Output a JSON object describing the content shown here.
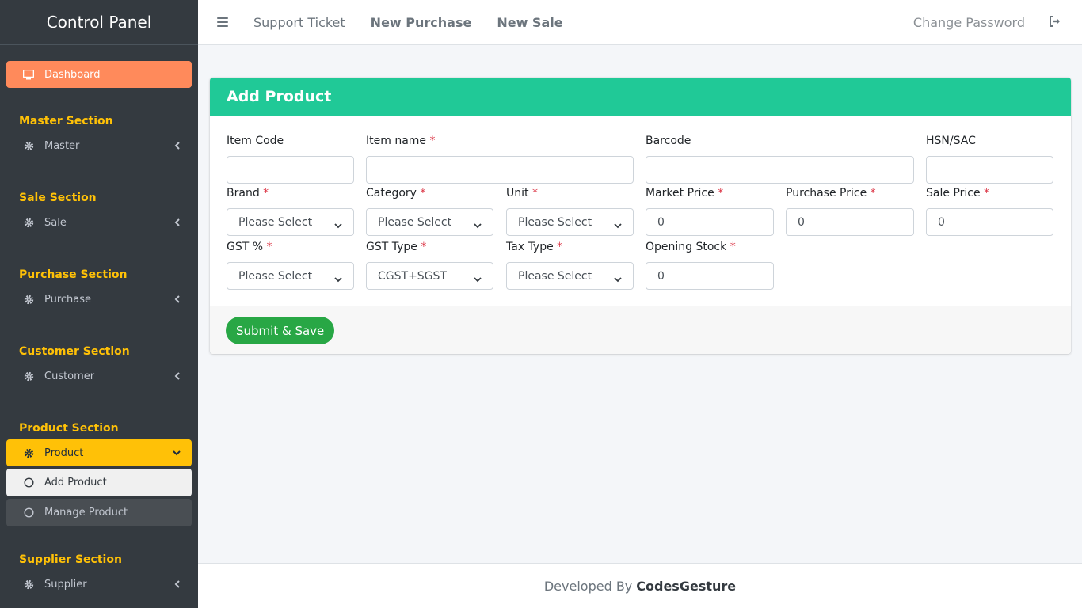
{
  "brand": "Control Panel",
  "sidebar": {
    "dashboard": "Dashboard",
    "sections": [
      {
        "title": "Master Section",
        "item": "Master"
      },
      {
        "title": "Sale Section",
        "item": "Sale"
      },
      {
        "title": "Purchase Section",
        "item": "Purchase"
      },
      {
        "title": "Customer Section",
        "item": "Customer"
      },
      {
        "title": "Product Section",
        "item": "Product"
      },
      {
        "title": "Supplier Section",
        "item": "Supplier"
      }
    ],
    "subitems": [
      "Add Product",
      "Manage Product"
    ]
  },
  "topbar": {
    "support": "Support Ticket",
    "new_purchase": "New Purchase",
    "new_sale": "New Sale",
    "change_password": "Change Password"
  },
  "form": {
    "title": "Add Product",
    "item_code": "Item Code",
    "item_name": "Item name",
    "barcode": "Barcode",
    "hsn": "HSN/SAC",
    "brand": "Brand",
    "category": "Category",
    "unit": "Unit",
    "market_price": "Market Price",
    "purchase_price": "Purchase Price",
    "sale_price": "Sale Price",
    "gst": "GST %",
    "gst_type": "GST Type",
    "tax_type": "Tax Type",
    "opening_stock": "Opening Stock",
    "select_placeholder": "Please Select",
    "gst_type_value": "CGST+SGST",
    "zero": "0",
    "required_mark": "*",
    "submit": "Submit & Save"
  },
  "footer": {
    "prefix": "Developed By",
    "name": "CodesGesture"
  },
  "colors": {
    "sidebar_bg": "#343a40",
    "dashboard_accent": "#ff8a5b",
    "section_yellow": "#ffc107",
    "card_header": "#20c997",
    "submit_green": "#28a745",
    "required_red": "#dc3545"
  }
}
